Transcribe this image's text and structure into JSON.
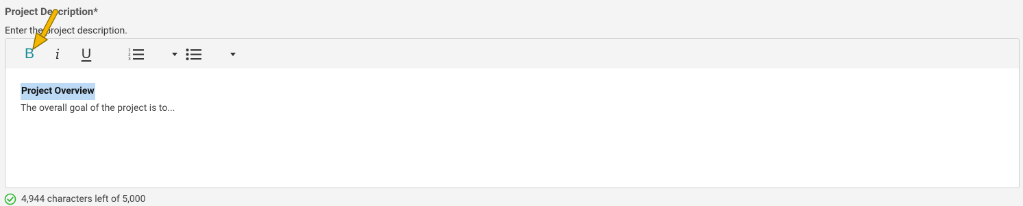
{
  "field": {
    "label": "Project Description*",
    "hint": "Enter the project description."
  },
  "toolbar": {
    "bold_label": "B",
    "italic_label": "i",
    "underline_label": "U",
    "icons": [
      "bold-icon",
      "italic-icon",
      "underline-icon",
      "ordered-list-icon",
      "dropdown-caret-icon",
      "bullet-list-icon",
      "dropdown-caret-icon"
    ]
  },
  "content": {
    "heading": "Project Overview",
    "body": "The overall goal of the project is to..."
  },
  "footer": {
    "status_text": "4,944 characters left of 5,000"
  },
  "colors": {
    "accent": "#1a8a98",
    "selection": "#bcd9f5",
    "success": "#2eb82e",
    "annotation_arrow": "#f5b800"
  }
}
